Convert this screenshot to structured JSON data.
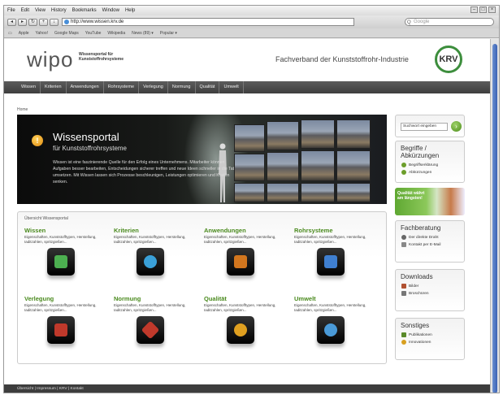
{
  "browser": {
    "menu": [
      "File",
      "Edit",
      "View",
      "History",
      "Bookmarks",
      "Window",
      "Help"
    ],
    "url": "http://www.wissen.krv.de",
    "search_placeholder": "Google",
    "bookmarks": [
      "Apple",
      "Yahoo!",
      "Google Maps",
      "YouTube",
      "Wikipedia",
      "News (89) ▾",
      "Popular ▾"
    ]
  },
  "header": {
    "logo": "wipo",
    "logo_sub_1": "Wissensportal für",
    "logo_sub_2": "Kunststoffrohrsysteme",
    "association": "Fachverband der Kunststoffrohr-Industrie",
    "krv": "KRV"
  },
  "nav": [
    "Wissen",
    "Kriterien",
    "Anwendungen",
    "Rohrsysteme",
    "Verlegung",
    "Normung",
    "Qualität",
    "Umwelt"
  ],
  "breadcrumb": "Home",
  "hero": {
    "title": "Wissensportal",
    "subtitle": "für Kunststoffrohrsysteme",
    "text": "Wissen ist eine faszinierende Quelle für den Erfolg eines Unternehmens. Mitarbeiter können Aufgaben besser bearbeiten, Entscheidungen sicherer treffen und neue Ideen schneller in die Tat umsetzen. Mit Wissen lassen sich Prozesse beschleunigen, Leistungen optimieren und Kosten senken."
  },
  "overview": {
    "title": "Übersicht Wissensportal",
    "categories": [
      {
        "title": "Wissen",
        "desc": "Eigenschaften, Kunststofftypen, Herstellung, Iaditzahlen, spritzgießen...",
        "color": "#4caf50"
      },
      {
        "title": "Kriterien",
        "desc": "Eigenschaften, Kunststofftypen, Herstellung, Iaditzahlen, spritzgießen...",
        "color": "#3aa0d8"
      },
      {
        "title": "Anwendungen",
        "desc": "Eigenschaften, Kunststofftypen, Herstellung, Iaditzahlen, spritzgießen...",
        "color": "#d2761e"
      },
      {
        "title": "Rohrsysteme",
        "desc": "Eigenschaften, Kunststofftypen, Herstellung, Iaditzahlen, spritzgießen...",
        "color": "#3f7fd0"
      },
      {
        "title": "Verlegung",
        "desc": "Eigenschaften, Kunststofftypen, Herstellung, Iaditzahlen, spritzgießen...",
        "color": "#c0392b"
      },
      {
        "title": "Normung",
        "desc": "Eigenschaften, Kunststofftypen, Herstellung, Iaditzahlen, spritzgießen...",
        "color": "#c0392b"
      },
      {
        "title": "Qualität",
        "desc": "Eigenschaften, Kunststofftypen, Herstellung, Iaditzahlen, spritzgießen...",
        "color": "#e0a020"
      },
      {
        "title": "Umwelt",
        "desc": "Eigenschaften, Kunststofftypen, Herstellung, Iaditzahlen, spritzgießen...",
        "color": "#4a9ad8"
      }
    ]
  },
  "sidebar": {
    "search_placeholder": "Suchwort eingeben",
    "terms": {
      "title": "Begriffe / Abkürzungen",
      "items": [
        "Begriffserklärung",
        "Abkürzungen"
      ]
    },
    "banner": "Qualität währt am längsten!",
    "advice": {
      "title": "Fachberatung",
      "items": [
        "Der direkte Draht",
        "Kontakt per E-Mail"
      ]
    },
    "downloads": {
      "title": "Downloads",
      "items": [
        "Bilder",
        "Broschüren"
      ]
    },
    "misc": {
      "title": "Sonstiges",
      "items": [
        "Publikationen",
        "Innovationen"
      ]
    }
  },
  "footer": "Übersicht | Impressum | KRV | Kontakt"
}
